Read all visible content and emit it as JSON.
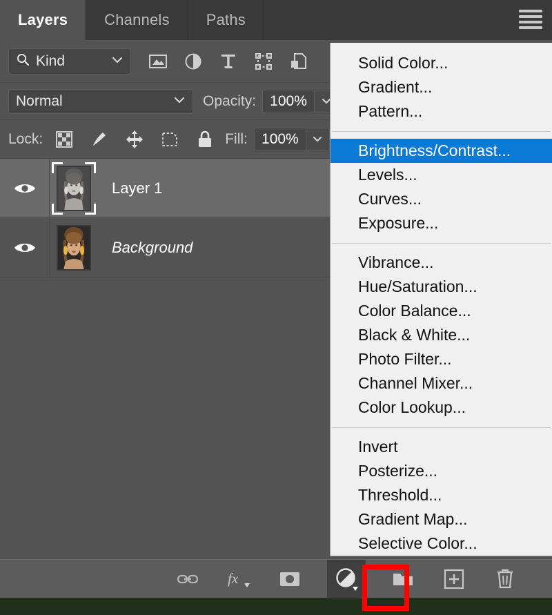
{
  "panel": {
    "tabs": [
      {
        "label": "Layers",
        "active": true
      },
      {
        "label": "Channels",
        "active": false
      },
      {
        "label": "Paths",
        "active": false
      }
    ],
    "menu_icon": "hamburger-menu-icon"
  },
  "filter_row": {
    "kind_label": "Kind",
    "search_icon": "search-icon",
    "chevron_icon": "chevron-down-icon",
    "filter_icons": [
      "pixel-layer-filter-icon",
      "adjustment-layer-filter-icon",
      "type-layer-filter-icon",
      "shape-layer-filter-icon",
      "smart-object-filter-icon",
      "filter-toggle-switch-icon"
    ]
  },
  "blend_row": {
    "blend_mode": "Normal",
    "opacity_label": "Opacity:",
    "opacity_value": "100%"
  },
  "lock_row": {
    "lock_label": "Lock:",
    "lock_icons": [
      "lock-transparent-pixels-icon",
      "lock-image-pixels-icon",
      "lock-position-icon",
      "lock-artboard-nesting-icon",
      "lock-all-icon"
    ],
    "fill_label": "Fill:",
    "fill_value": "100%"
  },
  "layers": [
    {
      "name": "Layer 1",
      "selected": true,
      "visible": true,
      "italic": false,
      "thumbnail": "grayscale-portrait-thumbnail"
    },
    {
      "name": "Background",
      "selected": false,
      "visible": true,
      "italic": true,
      "thumbnail": "color-portrait-thumbnail"
    }
  ],
  "bottom_toolbar": {
    "buttons": [
      {
        "name": "link-layers-button",
        "icon": "chain-link-icon"
      },
      {
        "name": "layer-style-button",
        "icon": "fx-icon"
      },
      {
        "name": "add-layer-mask-button",
        "icon": "mask-icon"
      },
      {
        "name": "new-adjustment-layer-button",
        "icon": "half-filled-circle-icon",
        "highlighted": true
      },
      {
        "name": "new-group-button",
        "icon": "folder-icon"
      },
      {
        "name": "new-layer-button",
        "icon": "plus-square-icon"
      },
      {
        "name": "delete-layer-button",
        "icon": "trash-icon"
      }
    ]
  },
  "context_menu": {
    "groups": [
      {
        "items": [
          {
            "label": "Solid Color...",
            "highlighted": false
          },
          {
            "label": "Gradient...",
            "highlighted": false
          },
          {
            "label": "Pattern...",
            "highlighted": false
          }
        ]
      },
      {
        "items": [
          {
            "label": "Brightness/Contrast...",
            "highlighted": true
          },
          {
            "label": "Levels...",
            "highlighted": false
          },
          {
            "label": "Curves...",
            "highlighted": false
          },
          {
            "label": "Exposure...",
            "highlighted": false
          }
        ]
      },
      {
        "items": [
          {
            "label": "Vibrance...",
            "highlighted": false
          },
          {
            "label": "Hue/Saturation...",
            "highlighted": false
          },
          {
            "label": "Color Balance...",
            "highlighted": false
          },
          {
            "label": "Black & White...",
            "highlighted": false
          },
          {
            "label": "Photo Filter...",
            "highlighted": false
          },
          {
            "label": "Channel Mixer...",
            "highlighted": false
          },
          {
            "label": "Color Lookup...",
            "highlighted": false
          }
        ]
      },
      {
        "items": [
          {
            "label": "Invert",
            "highlighted": false
          },
          {
            "label": "Posterize...",
            "highlighted": false
          },
          {
            "label": "Threshold...",
            "highlighted": false
          },
          {
            "label": "Gradient Map...",
            "highlighted": false
          },
          {
            "label": "Selective Color...",
            "highlighted": false
          }
        ]
      }
    ]
  },
  "colors": {
    "panel_bg": "#535353",
    "tabstrip_bg": "#393939",
    "selected_row": "#6a6a6a",
    "menu_bg": "#f0f0f0",
    "menu_highlight": "#0b7ad5",
    "highlight_box": "#fe0000",
    "toolbar_bg": "#5c5c5c",
    "canvas_strip": "#20301a"
  }
}
